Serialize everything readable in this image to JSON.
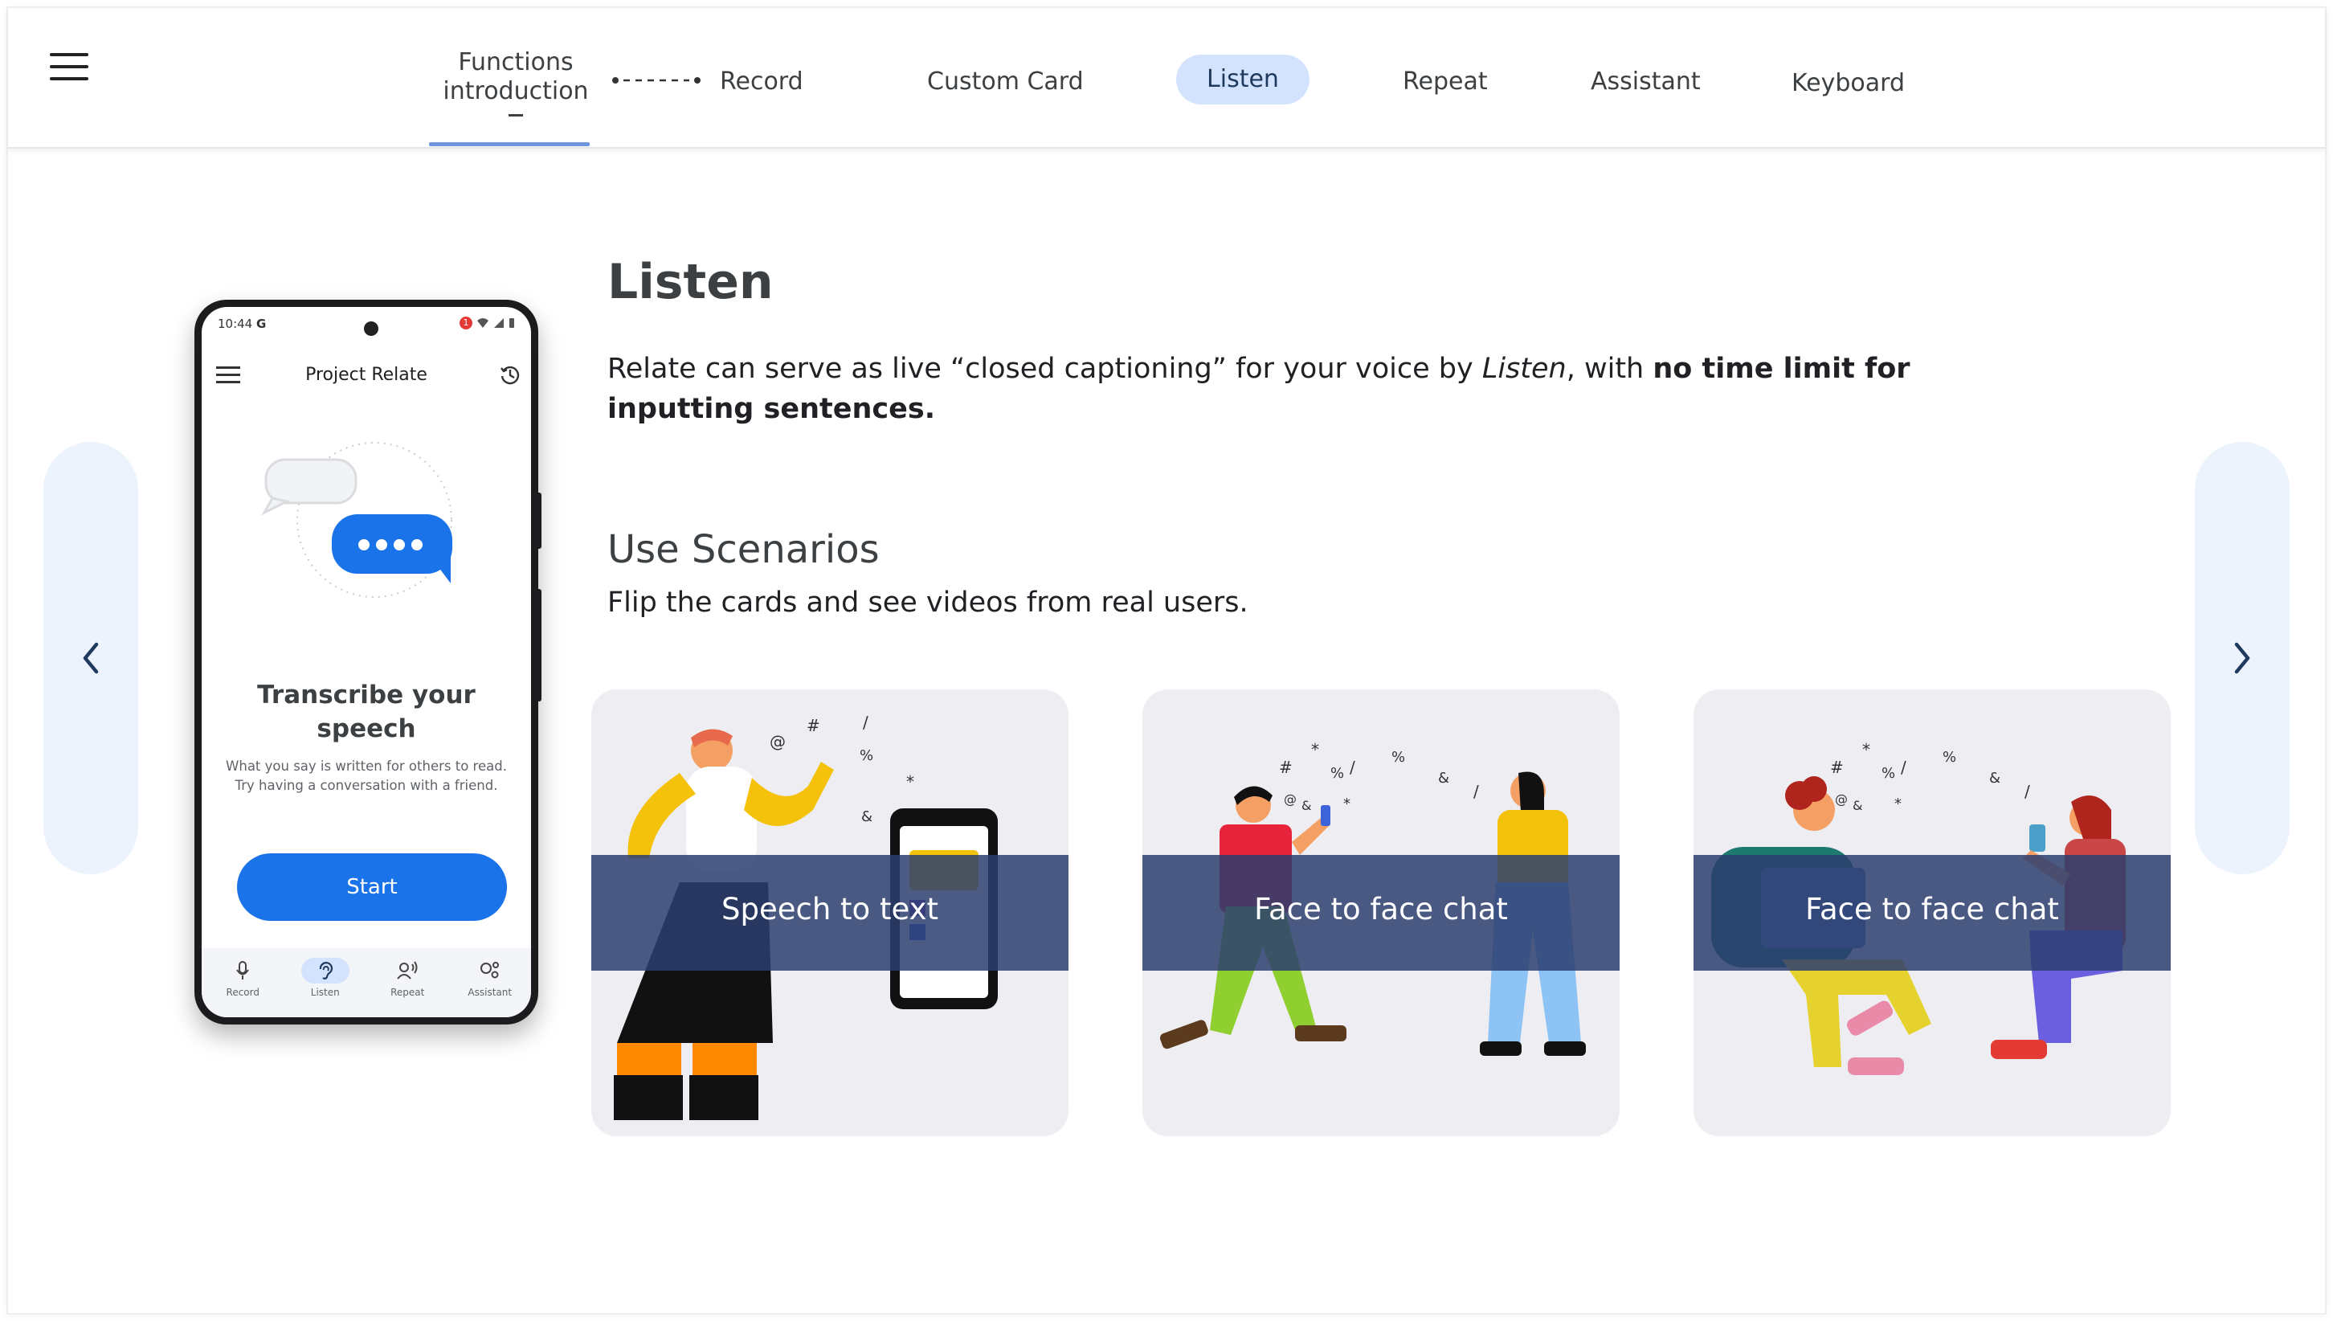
{
  "nav": {
    "menu_icon": "hamburger-menu-icon",
    "items": [
      {
        "label": "Functions\nintroduction"
      },
      {
        "label": "Record"
      },
      {
        "label": "Custom Card"
      },
      {
        "label": "Listen",
        "active": true
      },
      {
        "label": "Repeat"
      },
      {
        "label": "Assistant"
      },
      {
        "label": "Keyboard"
      }
    ],
    "func_line1": "Functions",
    "func_line2": "introduction",
    "record": "Record",
    "custom_card": "Custom Card",
    "listen": "Listen",
    "repeat": "Repeat",
    "assistant": "Assistant",
    "keyboard": "Keyboard"
  },
  "colors": {
    "accent_blue": "#1a73e8",
    "active_pill": "#d3e3fd",
    "side_panel": "#edf3fd",
    "card_band": "#2c3e6e"
  },
  "phone": {
    "time": "10:44",
    "carrier_glyph": "G",
    "notification_count": "1",
    "app_title": "Project Relate",
    "headline": "Transcribe your speech",
    "description": "What you say is written for others to read. Try having a conversation with a friend.",
    "start_label": "Start",
    "tabs": {
      "record": "Record",
      "listen": "Listen",
      "repeat": "Repeat",
      "assistant": "Assistant"
    }
  },
  "content": {
    "title": "Listen",
    "desc_part1": "Relate can serve as live “closed captioning” for your voice by ",
    "desc_italic": "Listen",
    "desc_part2": ", with ",
    "desc_bold": "no time limit for inputting sentences.",
    "scenarios_title": "Use Scenarios",
    "scenarios_desc": "Flip the cards and see videos from real users."
  },
  "cards": [
    {
      "label": "Speech to text"
    },
    {
      "label": "Face to face chat"
    },
    {
      "label": "Face to face chat"
    }
  ],
  "card1_label": "Speech to text",
  "card2_label": "Face to face chat",
  "card3_label": "Face to face chat"
}
